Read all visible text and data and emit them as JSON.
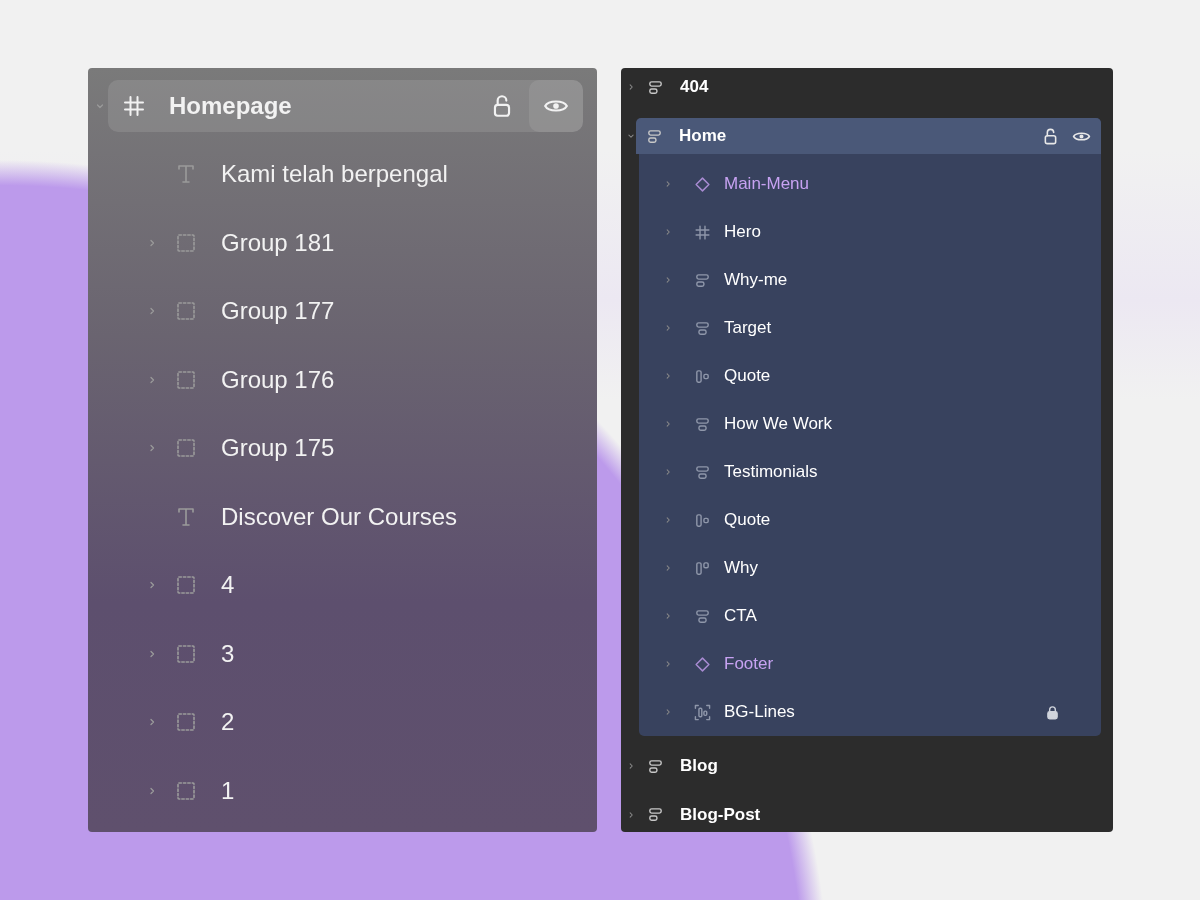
{
  "layers_panel": {
    "items": [
      {
        "name": "Homepage",
        "kind": "frame",
        "expanded": true,
        "hovered": true,
        "children": [
          {
            "name": "Kami telah berpengal",
            "kind": "text",
            "hovered": false
          },
          {
            "name": "Group 181",
            "kind": "group",
            "expanded": false,
            "hovered": false
          },
          {
            "name": "Group 177",
            "kind": "group",
            "expanded": false,
            "hovered": false
          },
          {
            "name": "Group 176",
            "kind": "group",
            "expanded": false,
            "hovered": false
          },
          {
            "name": "Group 175",
            "kind": "group",
            "expanded": false,
            "hovered": false
          },
          {
            "name": "Discover Our Courses",
            "kind": "text",
            "hovered": false
          },
          {
            "name": "4",
            "kind": "group",
            "expanded": false,
            "hovered": false
          },
          {
            "name": "3",
            "kind": "group",
            "expanded": false,
            "hovered": false
          },
          {
            "name": "2",
            "kind": "group",
            "expanded": false,
            "hovered": false
          },
          {
            "name": "1",
            "kind": "group",
            "expanded": false,
            "hovered": false
          }
        ]
      }
    ]
  },
  "navigator_panel": {
    "items": [
      {
        "name": "404",
        "kind": "stack",
        "expanded": false,
        "selected": false,
        "hovered": false,
        "locked": false
      },
      {
        "name": "Home",
        "kind": "stack",
        "expanded": true,
        "selected": true,
        "hovered": true,
        "locked": false,
        "children": [
          {
            "name": "Main-Menu",
            "kind": "component",
            "expanded": false,
            "selected": false,
            "hovered": false,
            "locked": false
          },
          {
            "name": "Hero",
            "kind": "frame",
            "expanded": false,
            "selected": false,
            "hovered": false,
            "locked": false
          },
          {
            "name": "Why-me",
            "kind": "stack",
            "expanded": false,
            "selected": false,
            "hovered": false,
            "locked": false
          },
          {
            "name": "Target",
            "kind": "stack-centered",
            "expanded": false,
            "selected": false,
            "hovered": false,
            "locked": false
          },
          {
            "name": "Quote",
            "kind": "row",
            "expanded": false,
            "selected": false,
            "hovered": false,
            "locked": false
          },
          {
            "name": "How We Work",
            "kind": "stack-centered",
            "expanded": false,
            "selected": false,
            "hovered": false,
            "locked": false
          },
          {
            "name": "Testimonials",
            "kind": "stack-centered",
            "expanded": false,
            "selected": false,
            "hovered": false,
            "locked": false
          },
          {
            "name": "Quote",
            "kind": "row",
            "expanded": false,
            "selected": false,
            "hovered": false,
            "locked": false
          },
          {
            "name": "Why",
            "kind": "row-top",
            "expanded": false,
            "selected": false,
            "hovered": false,
            "locked": false
          },
          {
            "name": "CTA",
            "kind": "stack-centered",
            "expanded": false,
            "selected": false,
            "hovered": false,
            "locked": false
          },
          {
            "name": "Footer",
            "kind": "component",
            "expanded": false,
            "selected": false,
            "hovered": false,
            "locked": false
          },
          {
            "name": "BG-Lines",
            "kind": "bg-lines",
            "expanded": false,
            "selected": false,
            "hovered": false,
            "locked": true
          }
        ]
      },
      {
        "name": "Blog",
        "kind": "stack",
        "expanded": false,
        "selected": false,
        "hovered": false,
        "locked": false
      },
      {
        "name": "Blog-Post",
        "kind": "stack",
        "expanded": false,
        "selected": false,
        "hovered": false,
        "locked": false
      }
    ]
  }
}
